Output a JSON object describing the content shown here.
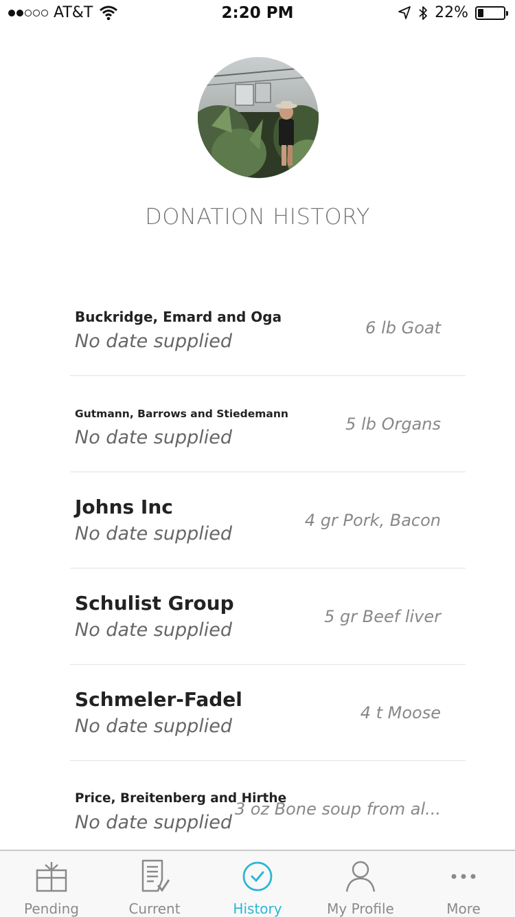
{
  "status_bar": {
    "carrier": "AT&T",
    "time": "2:20 PM",
    "battery": "22%",
    "battery_level": 0.22,
    "signal_bars_filled": 2,
    "signal_bars_total": 5
  },
  "header": {
    "title": "DONATION HISTORY"
  },
  "donations": [
    {
      "name": "Buckridge, Emard and Oga",
      "date": "No date supplied",
      "amount": "6 lb Goat"
    },
    {
      "name": "Gutmann, Barrows and Stiedemann",
      "date": "No date supplied",
      "amount": "5 lb Organs"
    },
    {
      "name": "Johns Inc",
      "date": "No date supplied",
      "amount": "4 gr Pork, Bacon"
    },
    {
      "name": "Schulist Group",
      "date": "No date supplied",
      "amount": "5 gr Beef liver"
    },
    {
      "name": "Schmeler-Fadel",
      "date": "No date supplied",
      "amount": "4 t Moose"
    },
    {
      "name": "Price, Breitenberg and Hirthe",
      "date": "No date supplied",
      "amount": "3 oz Bone soup from al..."
    }
  ],
  "tabs": [
    {
      "label": "Pending",
      "icon": "gift-icon"
    },
    {
      "label": "Current",
      "icon": "checklist-icon"
    },
    {
      "label": "History",
      "icon": "clock-check-icon"
    },
    {
      "label": "My Profile",
      "icon": "person-icon"
    },
    {
      "label": "More",
      "icon": "more-icon"
    }
  ],
  "colors": {
    "accent": "#2bb6d6",
    "inactive_tab": "#8a8a8a",
    "title": "#777777"
  }
}
